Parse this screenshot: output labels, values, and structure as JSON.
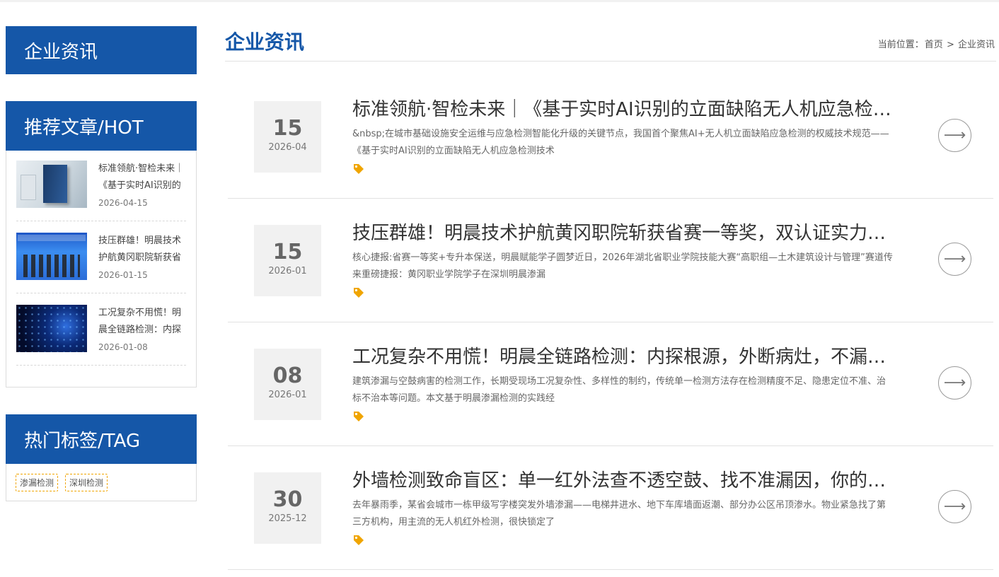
{
  "sidebar": {
    "section_title": "企业资讯",
    "hot": {
      "title": "推荐文章/HOT",
      "items": [
        {
          "title": "标准领航·智检未来｜《基于实时AI识别的立面缺陷无人机应急检测技术",
          "date": "2026-04-15"
        },
        {
          "title": "技压群雄！明晨技术护航黄冈职院斩获省赛一等奖",
          "date": "2026-01-15"
        },
        {
          "title": "工况复杂不用慌！明晨全链路检测：内探根源",
          "date": "2026-01-08"
        }
      ]
    },
    "tags": {
      "title": "热门标签/TAG",
      "items": [
        "渗漏检测",
        "深圳检测"
      ]
    }
  },
  "main": {
    "title": "企业资讯",
    "breadcrumb": {
      "prefix": "当前位置：",
      "home": "首页",
      "separator": ">",
      "current": "企业资讯"
    },
    "articles": [
      {
        "day": "15",
        "year_month": "2026-04",
        "title": "标准领航·智检未来｜《基于实时AI识别的立面缺陷无人机应急检测技术规范》",
        "desc": "&nbsp;在城市基础设施安全运维与应急检测智能化升级的关键节点，我国首个聚焦AI+无人机立面缺陷应急检测的权威技术规范——《基于实时AI识别的立面缺陷无人机应急检测技术"
      },
      {
        "day": "15",
        "year_month": "2026-01",
        "title": "技压群雄！明晨技术护航黄冈职院斩获省赛一等奖，双认证实力见证",
        "desc": "核心捷报:省赛一等奖+专升本保送，明晨赋能学子圆梦近日，2026年湖北省职业学院技能大赛“高职组—土木建筑设计与管理”赛道传来重磅捷报：黄冈职业学院学子在深圳明晨渗漏"
      },
      {
        "day": "08",
        "year_month": "2026-01",
        "title": "工况复杂不用慌！明晨全链路检测：内探根源，外断病灶，不漏一处隐患",
        "desc": "建筑渗漏与空鼓病害的检测工作，长期受现场工况复杂性、多样性的制约，传统单一检测方法存在检测精度不足、隐患定位不准、治标不治本等问题。本文基于明晨渗漏检测的实践经"
      },
      {
        "day": "30",
        "year_month": "2025-12",
        "title": "外墙检测致命盲区：单一红外法查不透空鼓、找不准漏因，你的房子还安全吗",
        "desc": "去年暴雨季，某省会城市一栋甲级写字楼突发外墙渗漏——电梯井进水、地下车库墙面返潮、部分办公区吊顶渗水。物业紧急找了第三方机构，用主流的无人机红外检测，很快锁定了"
      }
    ]
  },
  "icons": {
    "tag": "tag-icon",
    "arrow": "arrow-right-icon"
  },
  "colors": {
    "brand": "#1557a8",
    "tag": "#f0a500"
  }
}
